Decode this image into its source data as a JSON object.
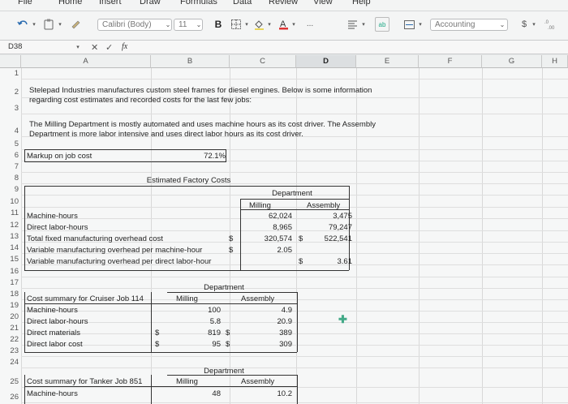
{
  "ribbon_tabs": [
    "File",
    "Home",
    "Insert",
    "Draw",
    "Formulas",
    "Data",
    "Review",
    "View",
    "Help"
  ],
  "toolbar": {
    "font_name": "Calibri (Body)",
    "font_size": "11",
    "bold_label": "B",
    "more_label": "...",
    "number_format": "Accounting",
    "currency_symbol": "$"
  },
  "formula_bar": {
    "name_box": "D38",
    "fx_label": "fx",
    "cancel": "✕",
    "enter": "✓",
    "content": ""
  },
  "columns": [
    "A",
    "B",
    "C",
    "D",
    "E",
    "F",
    "G",
    "H"
  ],
  "selected_column": "D",
  "rows": [
    "1",
    "2",
    "3",
    "4",
    "5",
    "6",
    "7",
    "8",
    "9",
    "10",
    "11",
    "12",
    "13",
    "14",
    "15",
    "16",
    "17",
    "18",
    "19",
    "20",
    "21",
    "22",
    "23",
    "24",
    "25",
    "26"
  ],
  "sheet": {
    "intro_1": "Stelepad Industries manufactures custom steel frames for diesel engines. Below is some information",
    "intro_2": "regarding cost estimates and recorded costs for the last few jobs:",
    "intro_3": "The Milling Department is mostly automated and uses machine hours as its cost driver. The Assembly",
    "intro_4": "Department is more labor intensive and uses direct labor hours as its cost driver.",
    "markup_label": "Markup on job cost",
    "markup_value": "72.1%",
    "estimated_title": "Estimated Factory Costs",
    "department_label": "Department",
    "milling_label": "Milling",
    "assembly_label": "Assembly",
    "est_rows": [
      {
        "label": "Machine-hours",
        "cur1": "",
        "milling": "62,024",
        "cur2": "",
        "assembly": "3,475"
      },
      {
        "label": "Direct labor-hours",
        "cur1": "",
        "milling": "8,965",
        "cur2": "",
        "assembly": "79,247"
      },
      {
        "label": "Total fixed manufacturing overhead cost",
        "cur1": "$",
        "milling": "320,574",
        "cur2": "$",
        "assembly": "522,541"
      },
      {
        "label": "Variable manufacturing overhead per machine-hour",
        "cur1": "$",
        "milling": "2.05",
        "cur2": "",
        "assembly": ""
      },
      {
        "label": "Variable manufacturing overhead per direct labor-hour",
        "cur1": "",
        "milling": "",
        "cur2": "$",
        "assembly": "3.61"
      }
    ],
    "cruiser_title": "Cost summary for Cruiser Job 114",
    "cruiser_rows": [
      {
        "label": "Machine-hours",
        "cur1": "",
        "milling": "100",
        "cur2": "",
        "assembly": "4.9"
      },
      {
        "label": "Direct labor-hours",
        "cur1": "",
        "milling": "5.8",
        "cur2": "",
        "assembly": "20.9"
      },
      {
        "label": "Direct materials",
        "cur1": "$",
        "milling": "819",
        "cur2": "$",
        "assembly": "389"
      },
      {
        "label": "Direct labor cost",
        "cur1": "$",
        "milling": "95",
        "cur2": "$",
        "assembly": "309"
      }
    ],
    "tanker_title": "Cost summary for Tanker Job 851",
    "tanker_rows": [
      {
        "label": "Machine-hours",
        "cur1": "",
        "milling": "48",
        "cur2": "",
        "assembly": "10.2"
      }
    ]
  }
}
